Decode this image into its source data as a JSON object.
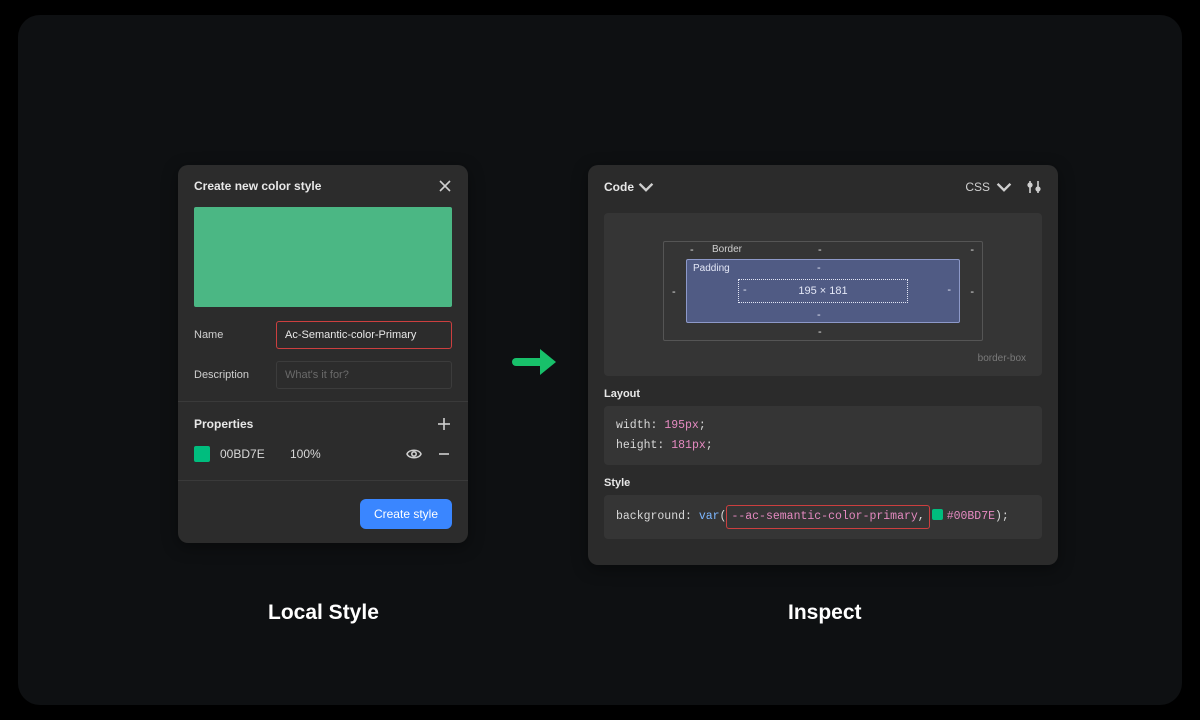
{
  "captions": {
    "left": "Local Style",
    "right": "Inspect"
  },
  "left_panel": {
    "title": "Create new color style",
    "swatch_color": "#4bb784",
    "name_label": "Name",
    "name_value": "Ac-Semantic-color-Primary",
    "desc_label": "Description",
    "desc_placeholder": "What's it for?",
    "properties_label": "Properties",
    "color_row": {
      "hex": "00BD7E",
      "opacity": "100%"
    },
    "create_button": "Create style"
  },
  "right_panel": {
    "code_label": "Code",
    "lang_label": "CSS",
    "box_model": {
      "border_label": "Border",
      "padding_label": "Padding",
      "content_size": "195 × 181",
      "box_sizing": "border-box",
      "dash": "-"
    },
    "layout_label": "Layout",
    "layout_code": {
      "line1_prop": "width",
      "line1_val": "195px",
      "line2_prop": "height",
      "line2_val": "181px"
    },
    "style_label": "Style",
    "style_code": {
      "prop": "background",
      "kw": "var",
      "varname": "--ac-semantic-color-primary",
      "hex": "#00BD7E"
    }
  }
}
